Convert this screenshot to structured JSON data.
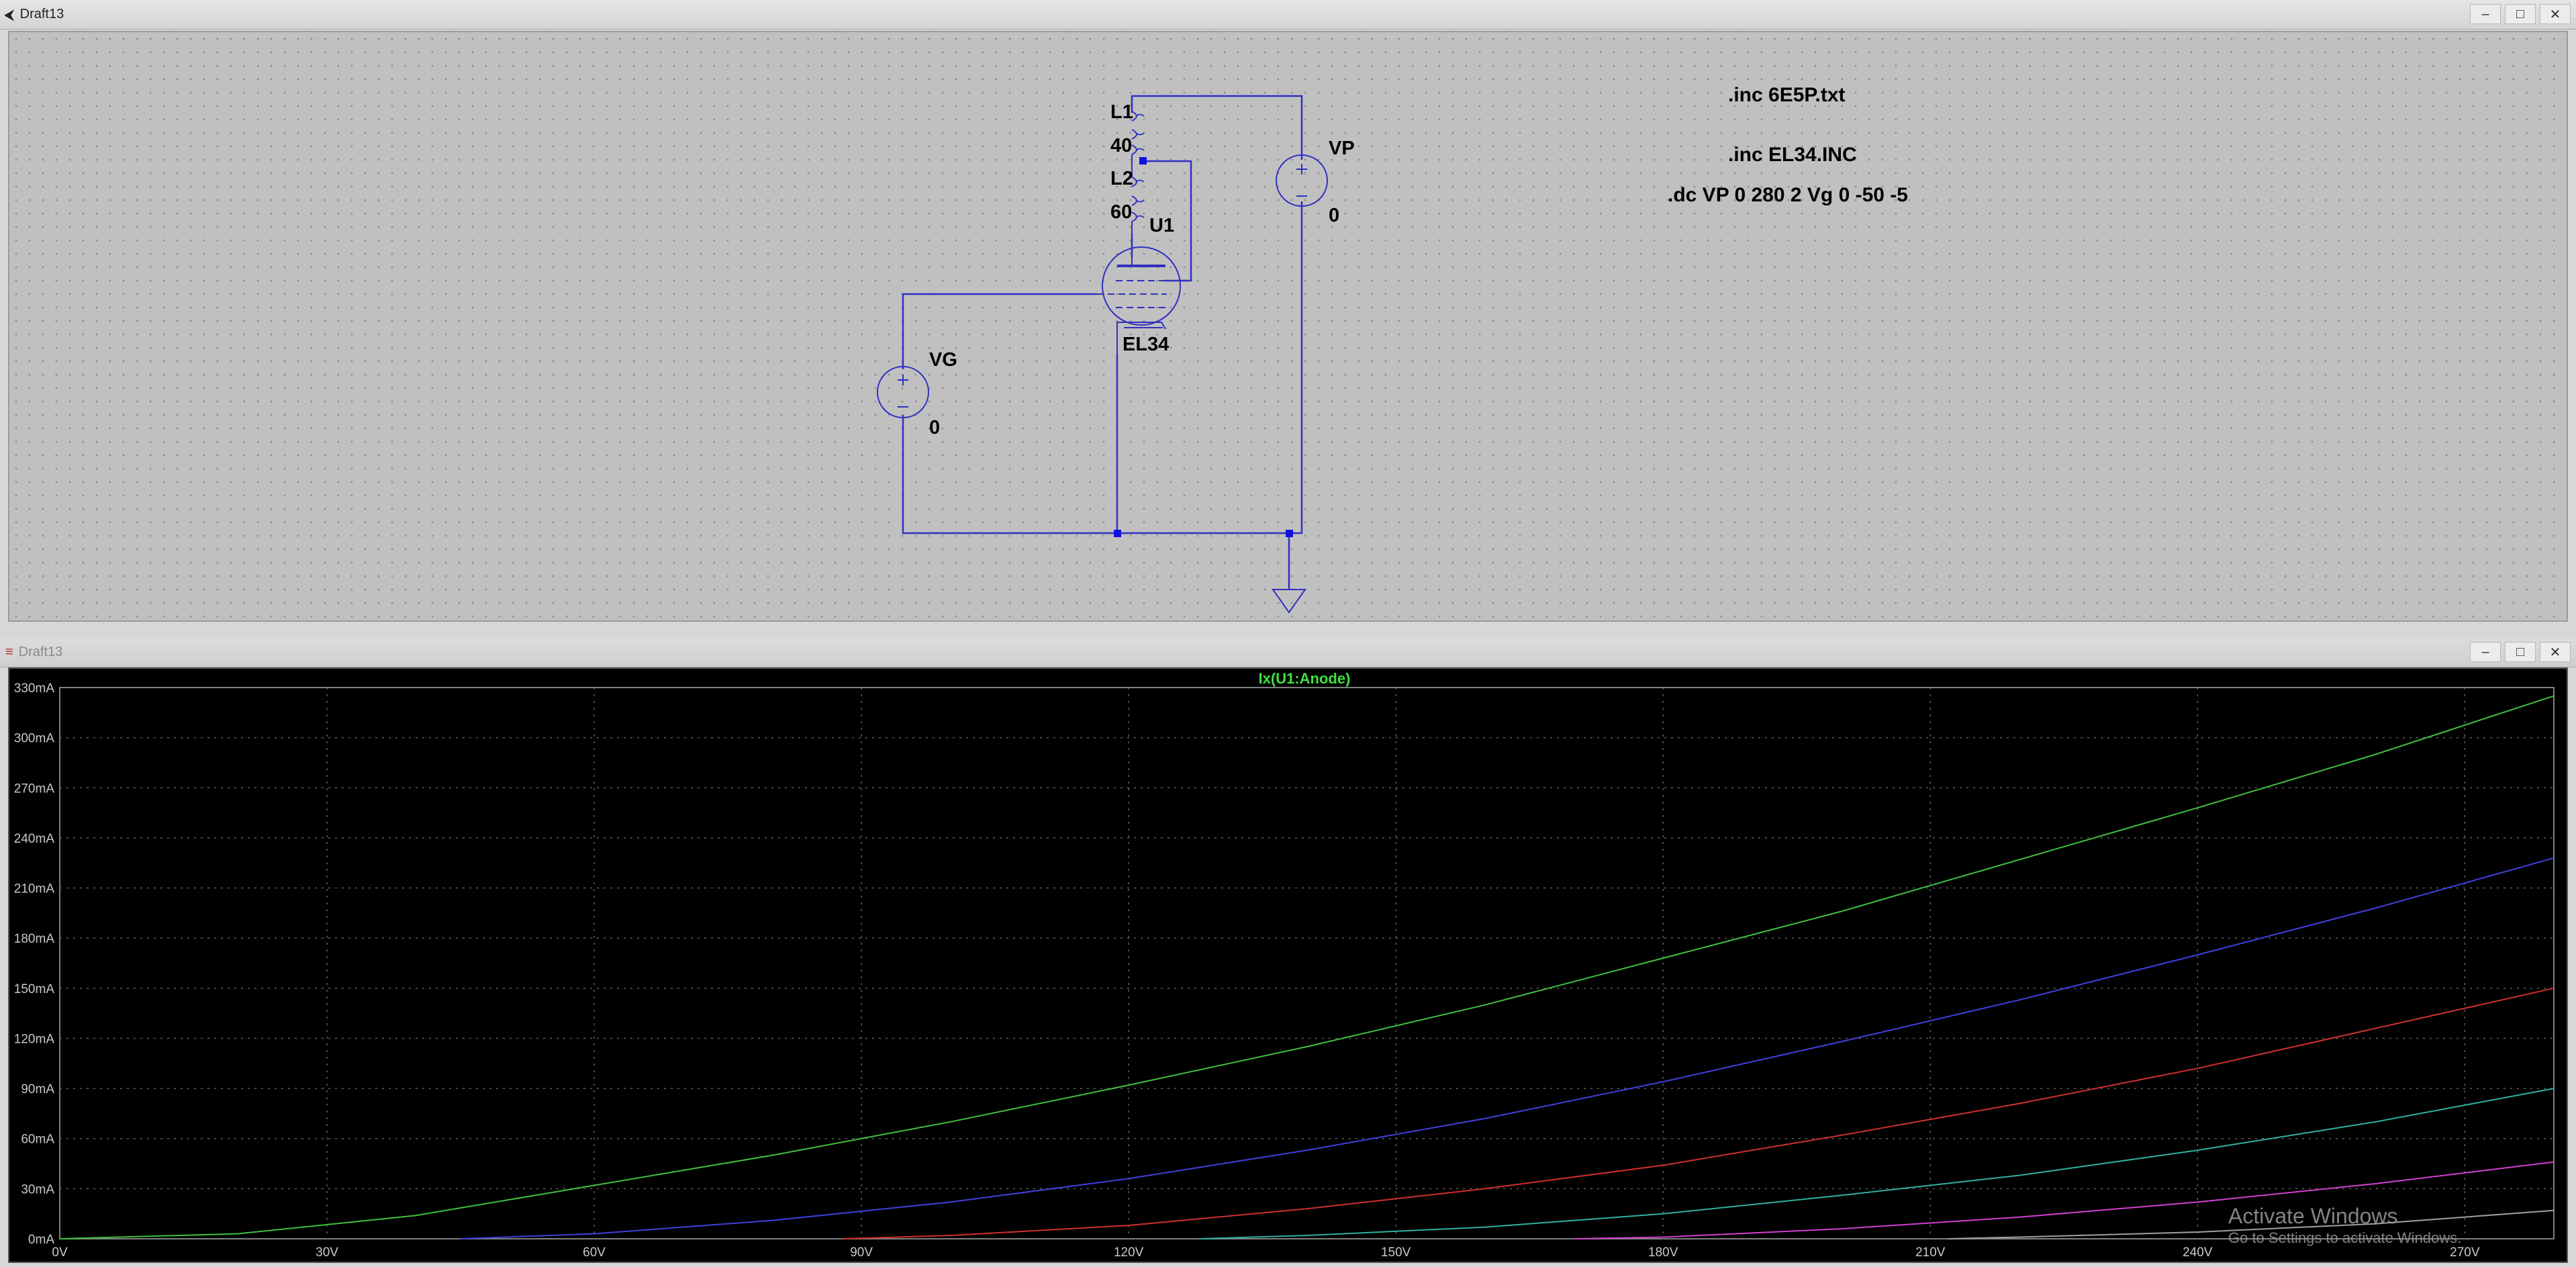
{
  "schematic_window": {
    "title": "Draft13"
  },
  "schematic": {
    "directives": [
      ".inc 6E5P.txt",
      ".inc EL34.INC",
      ".dc VP 0 280 2 Vg 0 -50 -5"
    ],
    "components": {
      "L1": {
        "name": "L1",
        "value": "40"
      },
      "L2": {
        "name": "L2",
        "value": "60"
      },
      "U1": {
        "name": "U1",
        "model": "EL34"
      },
      "VG": {
        "name": "VG",
        "value": "0"
      },
      "VP": {
        "name": "VP",
        "value": "0"
      }
    }
  },
  "plot_window": {
    "title": "Draft13"
  },
  "watermark": {
    "line1": "Activate Windows",
    "line2": "Go to Settings to activate Windows."
  },
  "colors": {
    "wire": "#3030c0",
    "node": "#1010e0",
    "plot_bg": "#000000",
    "grid": "#606060",
    "axis_text": "#c8c8c8",
    "trace_title": "#40e040"
  },
  "chart_data": {
    "type": "line",
    "title": "Ix(U1:Anode)",
    "xlabel": "",
    "ylabel": "",
    "xlim": [
      0,
      280
    ],
    "ylim": [
      0,
      330
    ],
    "xticks": [
      0,
      30,
      60,
      90,
      120,
      150,
      180,
      210,
      240,
      270
    ],
    "xtick_labels": [
      "0V",
      "30V",
      "60V",
      "90V",
      "120V",
      "150V",
      "180V",
      "210V",
      "240V",
      "270V"
    ],
    "yticks": [
      0,
      30,
      60,
      90,
      120,
      150,
      180,
      210,
      240,
      270,
      300,
      330
    ],
    "ytick_labels": [
      "0mA",
      "30mA",
      "60mA",
      "90mA",
      "120mA",
      "150mA",
      "180mA",
      "210mA",
      "240mA",
      "270mA",
      "300mA",
      "330mA"
    ],
    "grid": true,
    "series": [
      {
        "color": "#40c040",
        "x": [
          0,
          20,
          40,
          60,
          80,
          100,
          120,
          140,
          160,
          180,
          200,
          220,
          240,
          260,
          280
        ],
        "y": [
          0,
          3,
          14,
          32,
          50,
          70,
          92,
          115,
          140,
          168,
          196,
          227,
          258,
          290,
          325
        ]
      },
      {
        "color": "#4040e0",
        "x": [
          45,
          60,
          80,
          100,
          120,
          140,
          160,
          180,
          200,
          220,
          240,
          260,
          280
        ],
        "y": [
          0,
          3,
          11,
          22,
          36,
          53,
          72,
          94,
          118,
          143,
          170,
          198,
          228
        ]
      },
      {
        "color": "#d03030",
        "x": [
          88,
          100,
          120,
          140,
          160,
          180,
          200,
          220,
          240,
          260,
          280
        ],
        "y": [
          0,
          2,
          8,
          18,
          30,
          44,
          62,
          81,
          102,
          126,
          150
        ]
      },
      {
        "color": "#30b0a0",
        "x": [
          128,
          140,
          160,
          180,
          200,
          220,
          240,
          260,
          280
        ],
        "y": [
          0,
          2,
          7,
          15,
          26,
          38,
          53,
          70,
          90
        ]
      },
      {
        "color": "#d040d0",
        "x": [
          170,
          180,
          200,
          220,
          240,
          260,
          280
        ],
        "y": [
          0,
          1,
          6,
          13,
          22,
          33,
          46
        ]
      },
      {
        "color": "#a0a0a0",
        "x": [
          212,
          220,
          240,
          260,
          280
        ],
        "y": [
          0,
          1,
          4,
          9,
          17
        ]
      }
    ]
  }
}
